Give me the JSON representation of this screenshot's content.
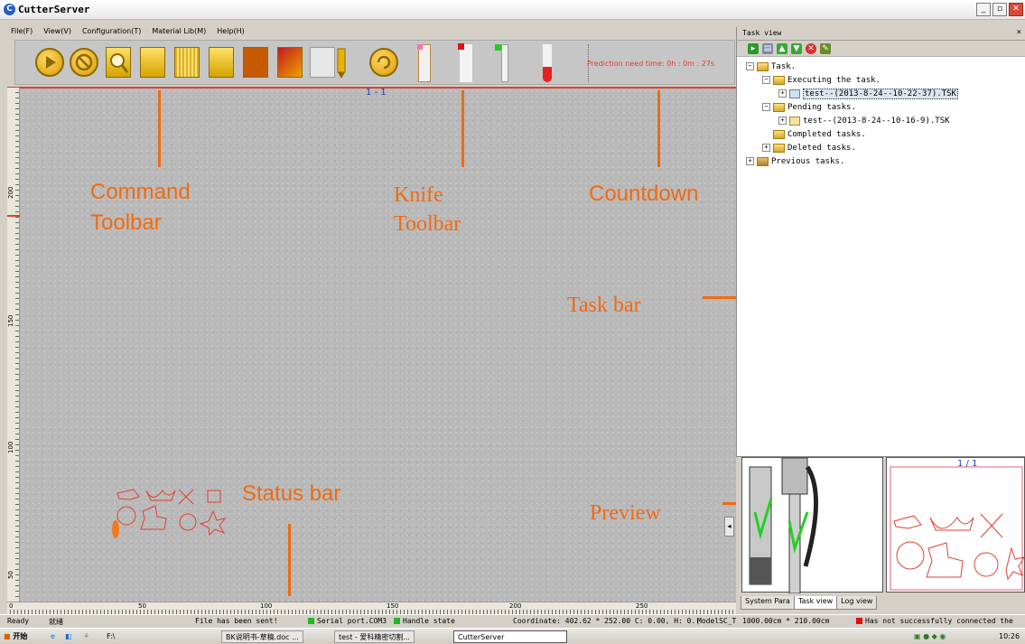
{
  "window": {
    "title": "CutterServer"
  },
  "menu": {
    "items": [
      "File(F)",
      "View(V)",
      "Configuration(T)",
      "Material Lib(M)",
      "Help(H)"
    ]
  },
  "command_toolbar": {
    "buttons": [
      "play-icon",
      "stop-icon",
      "zoom-icon",
      "material-icon",
      "pattern-icon",
      "fill-icon",
      "rotate-icon",
      "grid-icon",
      "person-icon",
      "knife-icon",
      "restart-icon"
    ]
  },
  "knife_toolbar": {
    "tools": [
      "knife-1",
      "knife-2",
      "knife-3",
      "knife-4"
    ]
  },
  "countdown": "Prediction need time: 0h : 0m : 27s",
  "canvas": {
    "page_indicator": "1 - 1",
    "ruler_left_marks": [
      "200",
      "150",
      "100",
      "50"
    ],
    "ruler_bottom_marks": [
      "0",
      "50",
      "100",
      "150",
      "200",
      "250"
    ]
  },
  "annotations": {
    "command_toolbar": "Command\nToolbar",
    "knife_toolbar": "Knife\nToolbar",
    "countdown": "Countdown",
    "task_bar": "Task bar",
    "status_bar": "Status bar",
    "preview": "Preview"
  },
  "task_view": {
    "header": "Task view",
    "close": "×",
    "tree": {
      "root": "Task.",
      "executing": "Executing the task.",
      "executing_item": "test--(2013-8-24--10-22-37).TSK",
      "pending": "Pending tasks.",
      "pending_item": "test--(2013-8-24--10-16-9).TSK",
      "completed": "Completed tasks.",
      "deleted": "Deleted tasks.",
      "previous": "Previous tasks."
    }
  },
  "preview": {
    "page": "1 / 1"
  },
  "tabs": [
    "System Para",
    "Task view",
    "Log view"
  ],
  "statusbar": {
    "ready": "Ready",
    "ready_cn": "就绪",
    "sent": "File has been sent!",
    "serial": "Serial port.COM3",
    "handle": "Handle state",
    "coordinate": "Coordinate: 402.62 * 252.00 C: 0.00, H: 0.(",
    "model": "ModelSC_T",
    "size": "1000.00cm * 210.00cm",
    "connection": "Has not successfully connected the"
  },
  "taskbar": {
    "start": "开始",
    "drive": "F:\\",
    "doc1": "BK说明书-草稿.doc ...",
    "doc2": "test - 爱科精密切割...",
    "app": "CutterServer",
    "time": "10:26"
  },
  "colors": {
    "accent": "#f06a10",
    "cut_lines": "#e04030",
    "toolbar_gold": "#e09a00"
  }
}
